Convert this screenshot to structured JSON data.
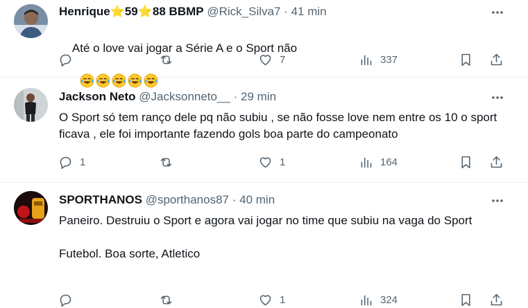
{
  "replies": [
    {
      "name": "Henrique⭐59⭐88 BBMP",
      "handle": "@Rick_Silva7",
      "separator": "·",
      "time": "41 min",
      "text": "Até o love vai jogar a Série A e o Sport não",
      "emoji_count": 5,
      "counts": {
        "replies": "",
        "reposts": "",
        "likes": "7",
        "views": "337"
      }
    },
    {
      "name": "Jackson Neto",
      "handle": "@Jacksonneto__",
      "separator": "·",
      "time": "29 min",
      "text": "O Sport só tem ranço dele pq não subiu , se não fosse love nem entre os 10 o sport ficava , ele foi importante fazendo gols boa parte do campeonato",
      "counts": {
        "replies": "1",
        "reposts": "",
        "likes": "1",
        "views": "164"
      }
    },
    {
      "name": "SPORTHANOS",
      "handle": "@sporthanos87",
      "separator": "·",
      "time": "40 min",
      "text": "Paneiro. Destruiu o Sport e agora vai jogar no time que subiu na vaga do Sport\n\nFutebol. Boa sorte, Atletico",
      "counts": {
        "replies": "",
        "reposts": "",
        "likes": "1",
        "views": "324"
      }
    }
  ],
  "icons": {
    "more": "more-icon",
    "reply": "reply-icon",
    "repost": "repost-icon",
    "like": "heart-icon",
    "views": "views-icon",
    "bookmark": "bookmark-icon",
    "share": "share-icon",
    "emoji": "tears-of-joy-emoji"
  },
  "colors": {
    "text": "#0f1419",
    "secondary": "#536471",
    "divider": "#eff3f4"
  }
}
